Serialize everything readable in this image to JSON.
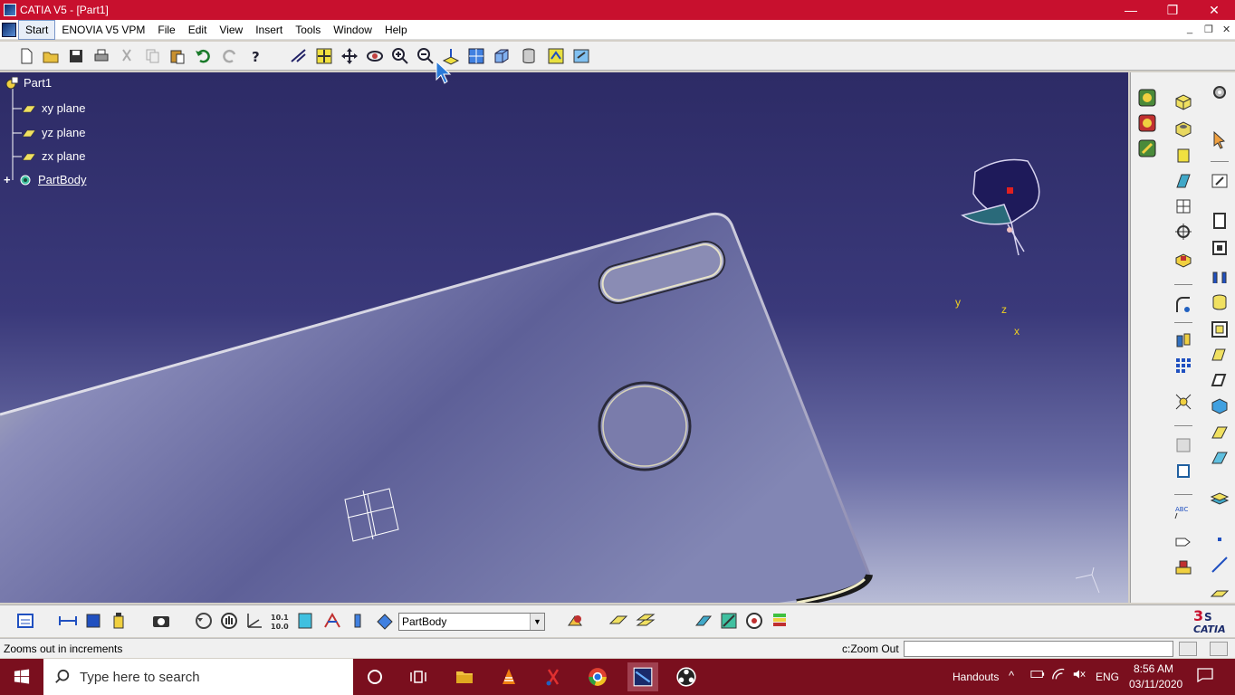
{
  "window": {
    "title": "CATIA V5 - [Part1]",
    "minimize": "—",
    "maximize": "❐",
    "close": "✕"
  },
  "menu": {
    "items": [
      "Start",
      "ENOVIA V5 VPM",
      "File",
      "Edit",
      "View",
      "Insert",
      "Tools",
      "Window",
      "Help"
    ],
    "mdi": [
      "_",
      "❐",
      "✕"
    ]
  },
  "tree": {
    "root": "Part1",
    "children": [
      "xy plane",
      "yz plane",
      "zx plane"
    ],
    "body": "PartBody"
  },
  "compass": {
    "x": "x",
    "y": "y",
    "z": "z"
  },
  "bottom": {
    "combo_value": "PartBody"
  },
  "status": {
    "message": "Zooms out in increments",
    "command_label": "c:Zoom Out",
    "command_value": ""
  },
  "taskbar": {
    "search_placeholder": "Type here to search",
    "tray_label": "Handouts",
    "language": "ENG",
    "time": "8:56 AM",
    "date": "03/11/2020"
  },
  "colors": {
    "title_bar": "#c8102e",
    "taskbar": "#7a0f1e",
    "viewport_top": "#2d2b66"
  }
}
